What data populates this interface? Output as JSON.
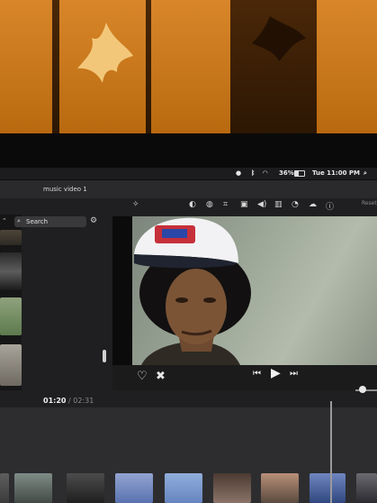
{
  "menubar": {
    "battery": "36%",
    "clock": "Tue 11:00 PM"
  },
  "window": {
    "title": "music video 1",
    "reset_label": "Reset"
  },
  "browser": {
    "search_placeholder": "Search"
  },
  "timeline": {
    "current_time": "01:20",
    "separator": "/",
    "total_time": "02:31"
  }
}
